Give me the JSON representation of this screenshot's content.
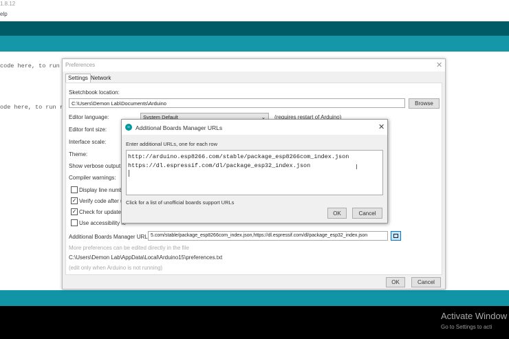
{
  "ide": {
    "version": "1.8.12",
    "menu_partial": "elp",
    "code_line1": "code here, to run o",
    "code_line2": "ode here, to run re"
  },
  "preferences": {
    "title": "Preferences",
    "tabs": [
      "Settings",
      "Network"
    ],
    "sketchbook_label": "Sketchbook location:",
    "sketchbook_value": "C:\\Users\\Demon Lab\\Documents\\Arduino",
    "browse": "Browse",
    "editor_language_label": "Editor language:",
    "editor_language_value": "System Default",
    "requires_restart": "(requires restart of Arduino)",
    "font_size_label": "Editor font size:",
    "interface_scale_label": "Interface scale:",
    "theme_label": "Theme:",
    "verbose_label": "Show verbose output d",
    "compiler_warnings_label": "Compiler warnings:",
    "checkboxes": [
      {
        "label": "Display line numbe",
        "checked": false
      },
      {
        "label": "Verify code after u",
        "checked": true
      },
      {
        "label": "Check for updates",
        "checked": true
      },
      {
        "label": "Use accessibility fe",
        "checked": false
      }
    ],
    "boards_urls_label": "Additional Boards Manager URLs:",
    "boards_urls_value": "5.com/stable/package_esp8266com_index.json,https://dl.espressif.com/dl/package_esp32_index.json",
    "more_prefs": "More preferences can be edited directly in the file",
    "prefs_path": "C:\\Users\\Demon Lab\\AppData\\Local\\Arduino15\\preferences.txt",
    "edit_only": "(edit only when Arduino is not running)",
    "ok": "OK",
    "cancel": "Cancel"
  },
  "boards_dialog": {
    "title": "Additional Boards Manager URLs",
    "instruction": "Enter additional URLs, one for each row",
    "urls": [
      "http://arduino.esp8266.com/stable/package_esp8266com_index.json",
      "https://dl.espressif.com/dl/package_esp32_index.json"
    ],
    "link": "Click for a list of unofficial boards support URLs",
    "ok": "OK",
    "cancel": "Cancel"
  },
  "watermark": {
    "title": "Activate Window",
    "subtitle": "Go to Settings to acti"
  },
  "colors": {
    "teal_dark": "#005c66",
    "teal": "#1597a8",
    "accent": "#0078d7"
  }
}
